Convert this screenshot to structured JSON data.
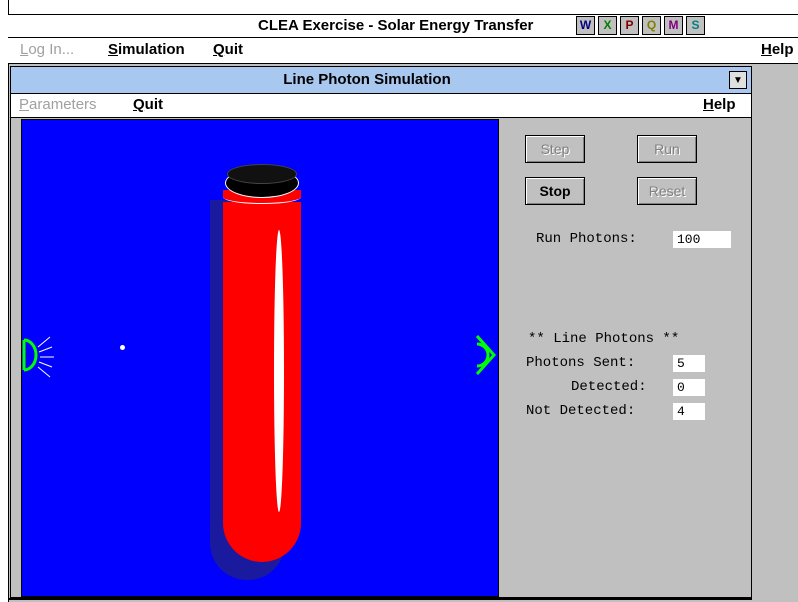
{
  "app": {
    "title": "CLEA Exercise - Solar Energy Transfer",
    "toolbar_icons": [
      "W",
      "X",
      "P",
      "Q",
      "M",
      "S"
    ]
  },
  "main_menu": {
    "login": "Log In...",
    "simulation": "Simulation",
    "quit": "Quit",
    "help": "Help"
  },
  "child_window": {
    "title": "Line Photon Simulation",
    "menu": {
      "parameters": "Parameters",
      "quit": "Quit",
      "help": "Help"
    }
  },
  "controls": {
    "step": "Step",
    "run": "Run",
    "stop": "Stop",
    "reset": "Reset",
    "run_photons_label": "Run Photons:",
    "run_photons_value": "100"
  },
  "stats": {
    "header": "** Line Photons **",
    "sent_label": "Photons Sent:",
    "sent_value": "5",
    "detected_label": "Detected:",
    "detected_value": "0",
    "not_detected_label": "Not Detected:",
    "not_detected_value": "4"
  },
  "colors": {
    "sim_background": "#0000ff",
    "tube": "#ff0000",
    "source": "#00ff00",
    "detector": "#00ff00"
  }
}
